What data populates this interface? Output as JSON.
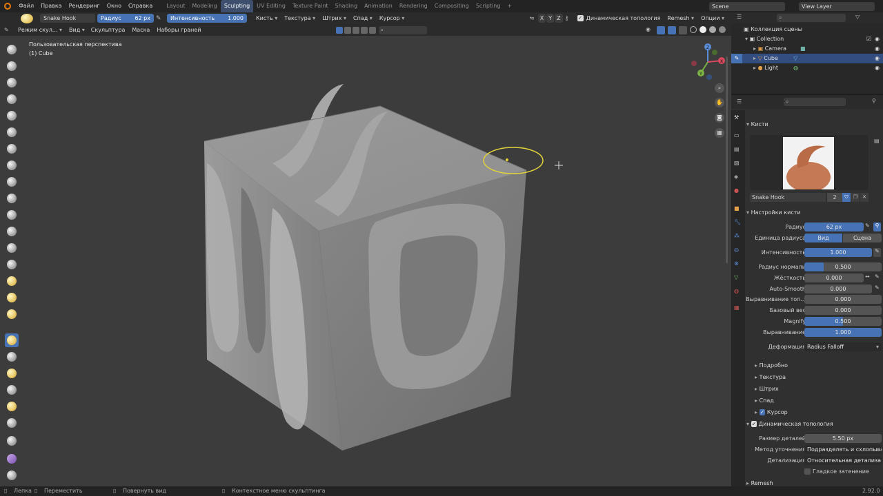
{
  "menu": [
    "Файл",
    "Правка",
    "Рендеринг",
    "Окно",
    "Справка"
  ],
  "workspaces": [
    {
      "label": "Layout",
      "active": false
    },
    {
      "label": "Modeling",
      "active": false
    },
    {
      "label": "Sculpting",
      "active": true
    },
    {
      "label": "UV Editing",
      "active": false
    },
    {
      "label": "Texture Paint",
      "active": false
    },
    {
      "label": "Shading",
      "active": false
    },
    {
      "label": "Animation",
      "active": false
    },
    {
      "label": "Rendering",
      "active": false
    },
    {
      "label": "Compositing",
      "active": false
    },
    {
      "label": "Scripting",
      "active": false
    }
  ],
  "scene_name": "Scene",
  "view_layer": "View Layer",
  "tool_header": {
    "brush_name": "Snake Hook",
    "radius_label": "Радиус",
    "radius_value": "62 px",
    "strength_label": "Интенсивность",
    "strength_value": "1.000",
    "dropdowns": [
      "Кисть",
      "Текстура",
      "Штрих",
      "Спад",
      "Курсор"
    ],
    "axes": [
      "X",
      "Y",
      "Z"
    ],
    "dyntopo_label": "Динамическая топология",
    "remesh_label": "Remesh",
    "options_label": "Опции"
  },
  "viewport_header": {
    "mode": "Режим скул...",
    "menus": [
      "Вид",
      "Скульптура",
      "Маска",
      "Наборы граней"
    ]
  },
  "viewport": {
    "perspective_label": "Пользовательская перспектива",
    "object_label": "(1) Cube",
    "gizmo": {
      "x": "X",
      "y": "Y",
      "z": "Z"
    }
  },
  "outliner": {
    "collection_root": "Коллекция сцены",
    "items": [
      {
        "label": "Collection",
        "indent": 1,
        "selected": false
      },
      {
        "label": "Camera",
        "indent": 2,
        "selected": false
      },
      {
        "label": "Cube",
        "indent": 2,
        "selected": true
      },
      {
        "label": "Light",
        "indent": 2,
        "selected": false
      }
    ]
  },
  "properties": {
    "brushes_header": "Кисти",
    "brush_name": "Snake Hook",
    "brush_users": "2",
    "settings_header": "Настройки кисти",
    "radius": {
      "label": "Радиус",
      "value": "62 px",
      "fill": 1.0
    },
    "radius_unit": {
      "label": "Единица радиуса",
      "options": [
        "Вид",
        "Сцена"
      ],
      "selected": "Вид"
    },
    "rows": [
      {
        "label": "Интенсивность",
        "value": "1.000",
        "fill": 1.0
      },
      {
        "label": "Радиус нормали",
        "value": "0.500",
        "fill": 0.25
      },
      {
        "label": "Жёсткость",
        "value": "0.000",
        "fill": 0.0
      },
      {
        "label": "Auto-Smooth",
        "value": "0.000",
        "fill": 0.0
      },
      {
        "label": "Выравнивание топ...",
        "value": "0.000",
        "fill": 0.0
      },
      {
        "label": "Базовый вес",
        "value": "0.000",
        "fill": 0.0
      },
      {
        "label": "Magnify",
        "value": "0.500",
        "fill": 0.5
      },
      {
        "label": "Выравнивание",
        "value": "1.000",
        "fill": 1.0
      }
    ],
    "deform": {
      "label": "Деформация",
      "value": "Radius Falloff"
    },
    "subsections": [
      "Подробно",
      "Текстура",
      "Штрих",
      "Спад",
      "Курсор"
    ],
    "dyntopo": {
      "header": "Динамическая топология",
      "detail_size": {
        "label": "Размер деталей",
        "value": "5.50 px"
      },
      "refine": {
        "label": "Метод уточнения",
        "value": "Подразделять и схлопыва..."
      },
      "detailing": {
        "label": "Детализация",
        "value": "Относительная детализа..."
      },
      "smooth_shading": "Гладкое затенение"
    },
    "remesh_header": "Remesh"
  },
  "status": {
    "left": "Лепка",
    "move": "Переместить",
    "rotate": "Повернуть вид",
    "context": "Контекстное меню скульптинга",
    "version": "2.92.0"
  },
  "colors": {
    "accent": "#4772b3",
    "brush_circle": "#e2d33a",
    "mesh": "#8c8c8c"
  }
}
